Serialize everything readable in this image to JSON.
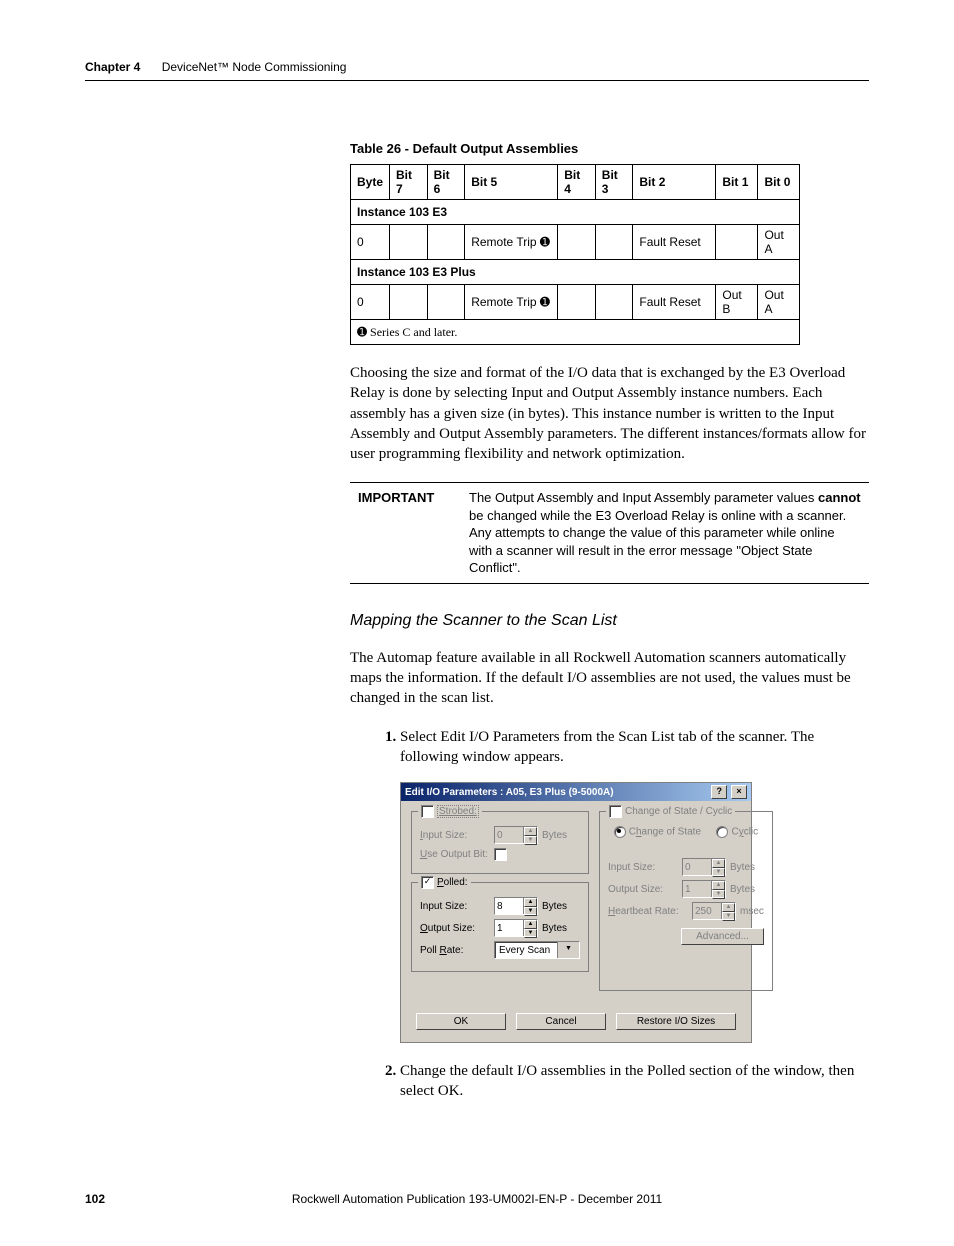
{
  "header": {
    "chapter": "Chapter 4",
    "title": "DeviceNet™ Node Commissioning"
  },
  "tableCaption": "Table 26 - Default Output Assemblies",
  "bitsHeader": [
    "Byte",
    "Bit 7",
    "Bit 6",
    "Bit 5",
    "Bit 4",
    "Bit 3",
    "Bit 2",
    "Bit 1",
    "Bit 0"
  ],
  "section1": "Instance 103 E3",
  "row1": {
    "byte": "0",
    "b5": "Remote Trip ➊",
    "b2": "Fault Reset",
    "b0": "Out A"
  },
  "section2": "Instance 103 E3 Plus",
  "row2": {
    "byte": "0",
    "b5": "Remote Trip ➊",
    "b2": "Fault Reset",
    "b1": "Out B",
    "b0": "Out A"
  },
  "footnote": "➊ Series C and later.",
  "para1": "Choosing the size and format of the I/O data that is exchanged by the E3 Overload Relay is done by selecting Input and Output Assembly instance numbers. Each assembly has a given size (in bytes). This instance number is written to the Input Assembly and Output Assembly parameters. The different instances/formats allow for user programming flexibility and network optimization.",
  "important": {
    "label": "IMPORTANT",
    "textA": "The Output Assembly and Input Assembly parameter values ",
    "bold": "cannot",
    "textB": " be changed while the E3 Overload Relay is online with a scanner. Any attempts to change the value of this parameter while online with a scanner will result in the error message \"Object State Conflict\"."
  },
  "subhead": "Mapping the Scanner to the Scan List",
  "para2": "The Automap feature available in all Rockwell Automation scanners automatically maps the information. If the default I/O assemblies are not used, the values must be changed in the scan list.",
  "step1": "Select Edit I/O Parameters from the Scan List tab of the scanner. The following window appears.",
  "step2": "Change the default I/O assemblies in the Polled section of the window, then select OK.",
  "dlg": {
    "title": "Edit I/O Parameters : A05, E3 Plus (9-5000A)",
    "strobed": "Strobed:",
    "inputSize": "Input Size:",
    "outputSize": "Output Size:",
    "useOutputBit": "Use Output Bit:",
    "polled": "Polled:",
    "pollRate": "Poll Rate:",
    "everyScan": "Every Scan",
    "cos": "Change of State / Cyclic",
    "cosOpt": "Change of State",
    "cyclicOpt": "Cyclic",
    "heartbeat": "Heartbeat Rate:",
    "advanced": "Advanced...",
    "ok": "OK",
    "cancel": "Cancel",
    "restore": "Restore I/O Sizes",
    "bytes": "Bytes",
    "msec": "msec",
    "v0": "0",
    "v8": "8",
    "v1": "1",
    "v250": "250"
  },
  "footer": {
    "page": "102",
    "pub": "Rockwell Automation Publication 193-UM002I-EN-P - December 2011"
  }
}
